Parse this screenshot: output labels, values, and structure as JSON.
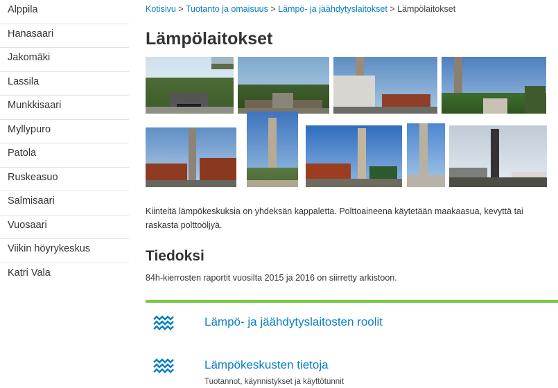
{
  "sidebar": {
    "items": [
      {
        "label": "Alppila"
      },
      {
        "label": "Hanasaari"
      },
      {
        "label": "Jakomäki"
      },
      {
        "label": "Lassila"
      },
      {
        "label": "Munkkisaari"
      },
      {
        "label": "Myllypuro"
      },
      {
        "label": "Patola"
      },
      {
        "label": "Ruskeasuo"
      },
      {
        "label": "Salmisaari"
      },
      {
        "label": "Vuosaari"
      },
      {
        "label": "Viikin höyrykeskus"
      },
      {
        "label": "Katri Vala"
      }
    ]
  },
  "breadcrumb": {
    "items": [
      "Kotisivu",
      "Tuotanto ja omaisuus",
      "Lämpö- ja jäähdytyslaitokset"
    ],
    "separator": ">",
    "current": "Lämpölaitokset"
  },
  "page": {
    "title": "Lämpölaitokset",
    "intro": "Kiinteitä lämpökeskuksia on yhdeksän kappaletta. Polttoaineena käytetään maakaasua, kevyttä tai raskasta polttoöljyä.",
    "section_title": "Tiedoksi",
    "section_text": "84h-kierrosten raportit vuosilta 2015 ja 2016 on siirretty arkistoon."
  },
  "links": [
    {
      "title": "Lämpö- ja jäähdytyslaitosten roolit",
      "subtitle": "",
      "icon": "wave-icon"
    },
    {
      "title": "Lämpökeskusten tietoja",
      "subtitle": "Tuotannot, käynnistykset ja käyttötunnit",
      "icon": "wave-icon"
    }
  ],
  "colors": {
    "link": "#0a7fc2",
    "accent_green": "#7ac943",
    "icon": "#0a7fc2"
  }
}
